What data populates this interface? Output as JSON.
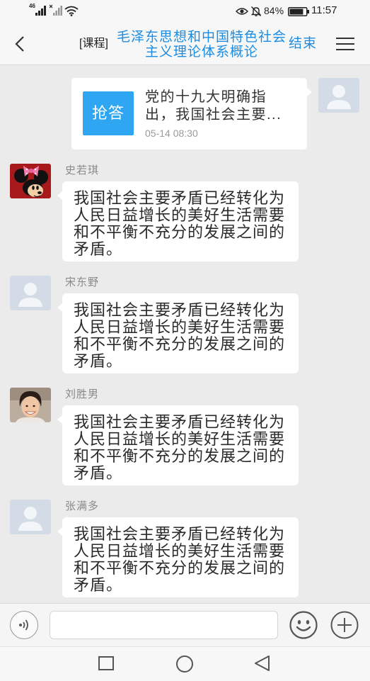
{
  "status_bar": {
    "network_label": "46",
    "battery_text": "84%",
    "battery_level": 0.84,
    "time": "11:57"
  },
  "header": {
    "course_tag": "[课程]",
    "title": "毛泽东思想和中国特色社会主义理论体系概论",
    "end_button": "结束"
  },
  "quick_answer": {
    "badge": "抢答",
    "text": "党的十九大明确指出，我国社会主要...",
    "time": "05-14 08:30",
    "avatar": "default-avatar"
  },
  "messages": [
    {
      "sender": "史若琪",
      "avatar": "minnie-mouse-avatar",
      "text": "我国社会主要矛盾已经转化为人民日益增长的美好生活需要和不平衡不充分的发展之间的矛盾。"
    },
    {
      "sender": "宋东野",
      "avatar": "default-avatar",
      "text": "我国社会主要矛盾已经转化为人民日益增长的美好生活需要和不平衡不充分的发展之间的矛盾。"
    },
    {
      "sender": "刘胜男",
      "avatar": "photo-avatar",
      "text": "我国社会主要矛盾已经转化为人民日益增长的美好生活需要和不平衡不充分的发展之间的矛盾。"
    },
    {
      "sender": "张满多",
      "avatar": "default-avatar",
      "text": "我国社会主要矛盾已经转化为人民日益增长的美好生活需要和不平衡不充分的发展之间的矛盾。"
    }
  ],
  "icons": {
    "back": "chevron-left-icon",
    "menu": "hamburger-menu-icon",
    "voice": "voice-icon",
    "emoji": "emoji-icon",
    "more": "plus-circle-icon",
    "nav_recent": "recent-apps-icon",
    "nav_home": "home-icon",
    "nav_back": "back-triangle-icon"
  },
  "colors": {
    "accent": "#1d8ce0",
    "badge": "#2ea6f1",
    "chat_background": "#ebebeb",
    "bubble": "#ffffff"
  }
}
